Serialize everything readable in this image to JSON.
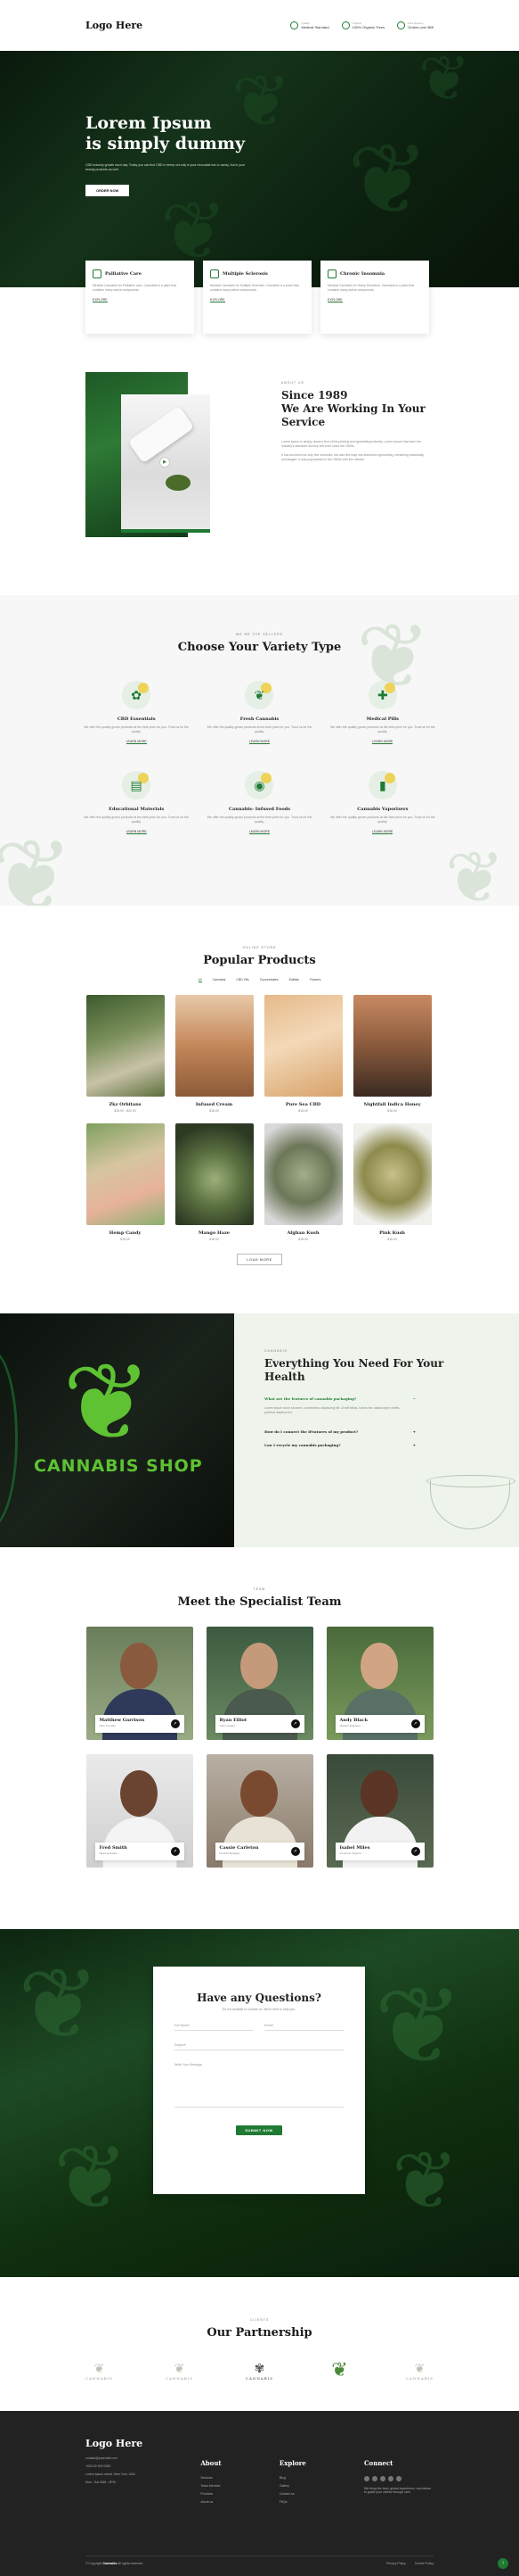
{
  "colors": {
    "brand": "#1f7a33",
    "accent": "#f2c81e",
    "dark": "#222222"
  },
  "header": {
    "logo": "Logo Here",
    "info": [
      {
        "icon": "check-badge-icon",
        "label": "Quality",
        "value": "Medical Standard"
      },
      {
        "icon": "leaf-icon",
        "label": "Organic",
        "value": "100% Organic Trees"
      },
      {
        "icon": "box-icon",
        "label": "Free Delivery",
        "value": "Orders over $65"
      }
    ]
  },
  "hero": {
    "title_line1": "Lorem Ipsum",
    "title_line2": "is simply dummy",
    "subtitle": "CBD industry growth each day. Today you can find CBD in hemp not only in your chocolate bar or candy, but in your beauty products as well.",
    "button": "ORDER NOW"
  },
  "features": [
    {
      "icon": "hand-icon",
      "title": "Palliative Care",
      "text": "Medical Cannabis for Palliative care. Cannabis is a plant that contains many active compounds.",
      "link": "EXPLORE"
    },
    {
      "icon": "pulse-icon",
      "title": "Multiple Sclerosis",
      "text": "Medical Cannabis for Multiple Sclerosis. Cannabis is a plant that contains many active compounds.",
      "link": "EXPLORE"
    },
    {
      "icon": "moon-icon",
      "title": "Chronic Insomnia",
      "text": "Medical Cannabis for Sleep Disorders. Cannabis is a plant that contains many active compounds.",
      "link": "EXPLORE"
    }
  ],
  "about": {
    "tag": "ABOUT US",
    "title_line1": "Since 1989",
    "title_line2": "We Are Working In Your",
    "title_line3": "Service",
    "p1": "Lorem ipsum is simply dummy text of the printing and typesetting industry. Lorem Ipsum has been the industry's standard dummy text ever since the 1500s.",
    "p2": "It has survived not only five centuries, but also the leap into electronic typesetting, remaining essentially unchanged. It was popularised in the 1960s with the release."
  },
  "variety": {
    "tag": "WE BE THE SELLERS",
    "title": "Choose Your Variety Type",
    "items": [
      {
        "icon": "cbd-essentials-icon",
        "glyph": "✿",
        "title": "CBD Essentials",
        "text": "We offer the quality grown products at the best price for you. Trust us for the quality.",
        "link": "LEARN MORE"
      },
      {
        "icon": "fresh-cannabis-icon",
        "glyph": "❦",
        "title": "Fresh Cannabis",
        "text": "We offer the quality grown products at the best price for you. Trust us for the quality.",
        "link": "LEARN MORE"
      },
      {
        "icon": "medical-pills-icon",
        "glyph": "✚",
        "title": "Medical Pills",
        "text": "We offer the quality grown products at the best price for you. Trust us for the quality.",
        "link": "LEARN MORE"
      },
      {
        "icon": "educational-materials-icon",
        "glyph": "▤",
        "title": "Educational Materials",
        "text": "We offer the quality grown products at the best price for you. Trust us for the quality.",
        "link": "LEARN MORE"
      },
      {
        "icon": "infused-foods-icon",
        "glyph": "◉",
        "title": "Cannabis- Infused Foods",
        "text": "We offer the quality grown products at the best price for you. Trust us for the quality.",
        "link": "LEARN MORE"
      },
      {
        "icon": "vaporizer-icon",
        "glyph": "▮",
        "title": "Cannabis Vaporizers",
        "text": "We offer the quality grown products at the best price for you. Trust us for the quality.",
        "link": "LEARN MORE"
      }
    ]
  },
  "products": {
    "tag": "ONLINE STORE",
    "title": "Popular Products",
    "tabs": [
      "All",
      "Cannabis",
      "CBD Oils",
      "Concentrates",
      "Edibles",
      "Flowers"
    ],
    "items": [
      {
        "name": "Zkz Orbitans",
        "price": "$18.00 - $20.00"
      },
      {
        "name": "Infused Cream",
        "price": "$18.00"
      },
      {
        "name": "Pure Sea CBD",
        "price": "$18.00"
      },
      {
        "name": "Nightfall Indica Honey",
        "price": "$18.00"
      },
      {
        "name": "Hemp Candy",
        "price": "$18.00"
      },
      {
        "name": "Mango Haze",
        "price": "$18.00"
      },
      {
        "name": "Afghan Kush",
        "price": "$18.00"
      },
      {
        "name": "Pink Kush",
        "price": "$18.00"
      }
    ],
    "more": "LOAD MORE"
  },
  "everything": {
    "shop_text": "CANNABIS SHOP",
    "tag": "CANNABIS",
    "title_line1": "Everything You Need For Your",
    "title_line2": "Health",
    "q1": "What are the features of cannabis packaging?",
    "a1": "Lorem ipsum dolor sit amet, consectetur adipiscing elit. Ut elit tellus, luctus nec ullamcorper mattis, pulvinar dapibus leo.",
    "q2": "How do I connect the iFeatures of my product?",
    "q3": "Can I recycle my cannabis packaging?"
  },
  "team": {
    "tag": "TEAM",
    "title": "Meet the Specialist Team",
    "members": [
      {
        "name": "Matthew Garrison",
        "role": "CEO Founder"
      },
      {
        "name": "Ryan Elliot",
        "role": "Team Leader"
      },
      {
        "name": "Andy Black",
        "role": "Support Engineer"
      },
      {
        "name": "Fred Smith",
        "role": "Sales Assistant"
      },
      {
        "name": "Cassie Carleton",
        "role": "Product Manager"
      },
      {
        "name": "Isabel Miles",
        "role": "Customer Support"
      }
    ]
  },
  "questions": {
    "title": "Have any Questions?",
    "subtitle": "Do not hesitate to contact us. We're here to help you.",
    "full_name": "Full Name*",
    "email": "Email*",
    "subject": "Subject*",
    "message": "Write Your Message",
    "button": "SUBMIT NOW"
  },
  "partners": {
    "tag": "CLIENTS",
    "title": "Our Partnership",
    "logos": [
      "CANNABIS",
      "CANNABIS",
      "CANNABIS",
      "",
      "CANNABIS"
    ]
  },
  "footer": {
    "logo": "Logo Here",
    "contact": [
      "contact@yourmail.com",
      "+000 00 000 0000",
      "Lorem ipsum street, New York, USA",
      "Mon - Sat 9AM - 6PM"
    ],
    "about_title": "About",
    "about_links": [
      "Services",
      "Team Member",
      "Products",
      "About us"
    ],
    "explore_title": "Explore",
    "explore_links": [
      "Blog",
      "Gallery",
      "Contact us",
      "FAQs"
    ],
    "connect_title": "Connect",
    "connect_text": "We bring the best, global experience, and desire to guide your clients through care.",
    "copyright_prefix": "© Copyright",
    "copyright_brand": "Cannabis",
    "copyright_suffix": "All rights reserved.",
    "legal": [
      "Privacy Policy",
      "Cookie Policy"
    ]
  }
}
